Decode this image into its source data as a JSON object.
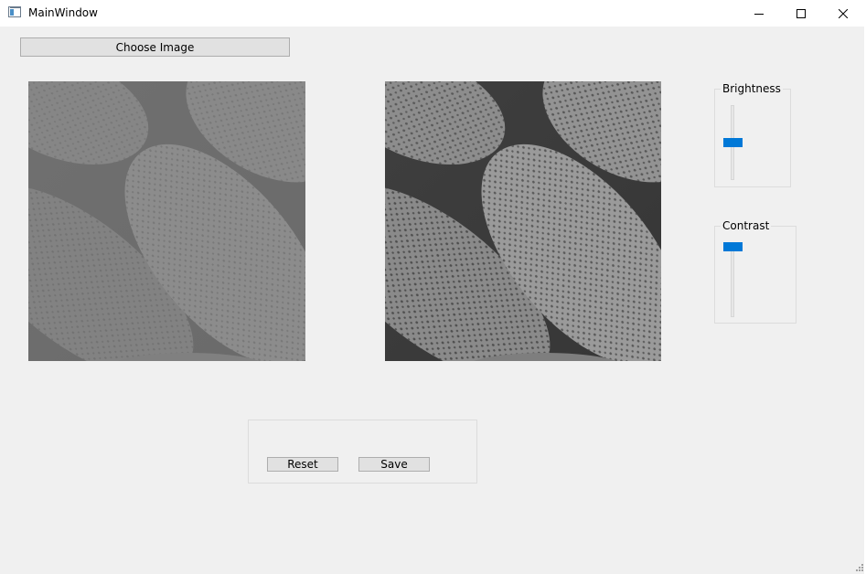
{
  "window": {
    "title": "MainWindow",
    "icon": "app-window-icon",
    "controls": {
      "minimize_icon": "minimize-icon",
      "maximize_icon": "maximize-icon",
      "close_icon": "close-icon"
    }
  },
  "toolbar": {
    "choose_image_label": "Choose Image"
  },
  "images": {
    "original": {
      "subject": "grayscale micrograph",
      "appearance": "low contrast"
    },
    "processed": {
      "subject": "grayscale micrograph",
      "appearance": "contrast enhanced"
    }
  },
  "controls": {
    "brightness": {
      "label": "Brightness",
      "orientation": "vertical",
      "level": 0.5
    },
    "contrast": {
      "label": "Contrast",
      "orientation": "vertical",
      "level": 1.0
    }
  },
  "actions": {
    "reset_label": "Reset",
    "save_label": "Save"
  },
  "colors": {
    "window_bg": "#f0f0f0",
    "titlebar_bg": "#ffffff",
    "slider_accent": "#0078d7",
    "button_bg": "#e1e1e1",
    "button_border": "#adadad"
  }
}
